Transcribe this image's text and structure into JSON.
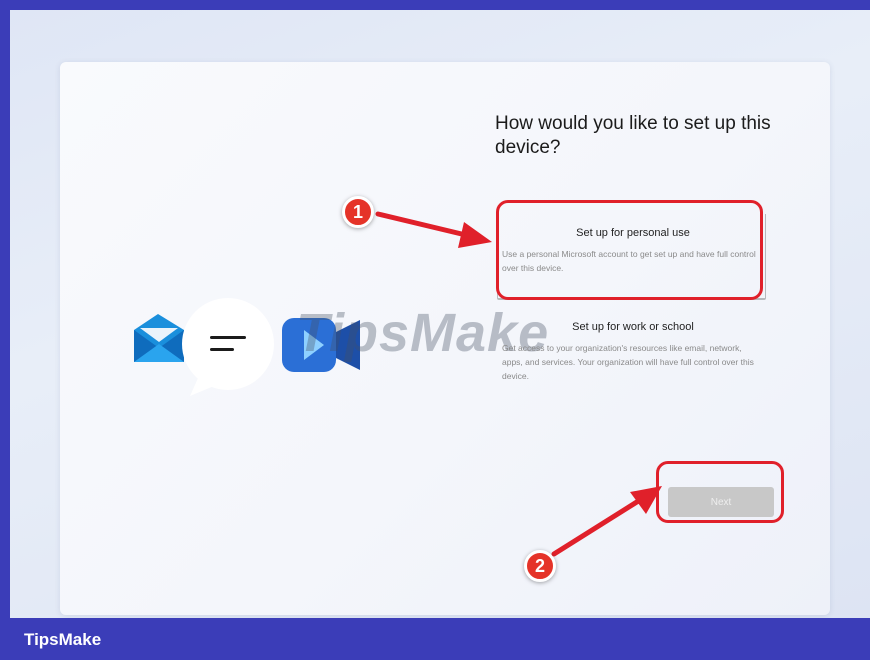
{
  "setup": {
    "heading": "How would you like to set up this device?",
    "options": [
      {
        "title": "Set up for personal use",
        "description": "Use a personal Microsoft account to get set up and have full control over this device."
      },
      {
        "title": "Set up for work or school",
        "description": "Get access to your organization's resources like email, network, apps, and services. Your organization will have full control over this device."
      }
    ],
    "next_label": "Next"
  },
  "annotations": {
    "badge_1": "1",
    "badge_2": "2",
    "highlight_color": "#e0202a"
  },
  "watermark": {
    "text": "TipsMake"
  },
  "footer": {
    "brand": "TipsMake"
  },
  "colors": {
    "frame": "#3b3db8",
    "badge": "#e53328"
  },
  "icons": [
    "mail-icon",
    "chat-bubble-icon",
    "video-camera-icon"
  ]
}
